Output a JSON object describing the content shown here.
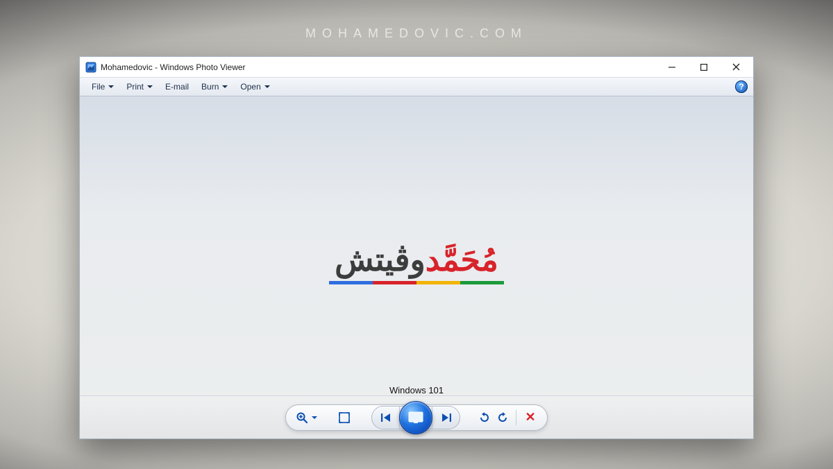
{
  "watermark": "MOHAMEDOVIC.COM",
  "window": {
    "title": "Mohamedovic - Windows Photo Viewer"
  },
  "menubar": {
    "items": [
      {
        "label": "File",
        "has_dropdown": true
      },
      {
        "label": "Print",
        "has_dropdown": true
      },
      {
        "label": "E-mail",
        "has_dropdown": false
      },
      {
        "label": "Burn",
        "has_dropdown": true
      },
      {
        "label": "Open",
        "has_dropdown": true
      }
    ],
    "help_glyph": "?"
  },
  "image": {
    "logo_text_plain": "مُحَمَّدوڤيتش",
    "logo_text_red": "مُحَمَّد",
    "logo_text_grey": "وڤيتش",
    "caption": "Windows 101",
    "underline_colors": [
      "#2f6ee0",
      "#d8232a",
      "#f2b400",
      "#1c9a3a"
    ]
  },
  "controls": {
    "zoom_glyph": "⊕",
    "delete_glyph": "✕"
  }
}
